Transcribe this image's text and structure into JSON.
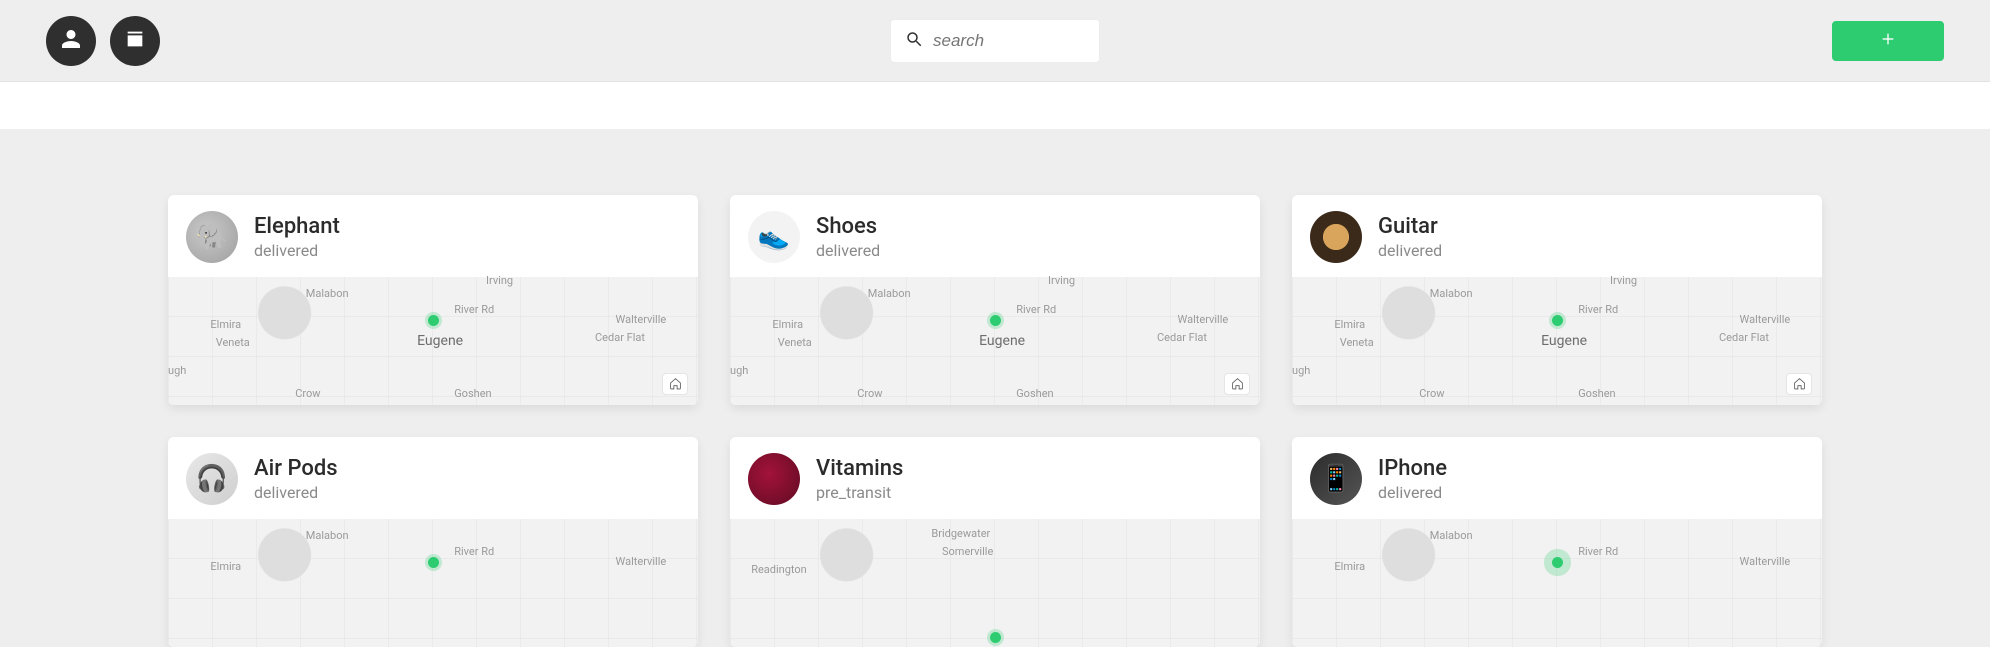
{
  "search": {
    "placeholder": "search"
  },
  "cards": [
    {
      "name": "Elephant",
      "status": "delivered",
      "avatar": "elephant",
      "map": "eugene"
    },
    {
      "name": "Shoes",
      "status": "delivered",
      "avatar": "shoes",
      "map": "eugene"
    },
    {
      "name": "Guitar",
      "status": "delivered",
      "avatar": "guitar",
      "map": "eugene"
    },
    {
      "name": "Air Pods",
      "status": "delivered",
      "avatar": "airpods",
      "map": "eugene"
    },
    {
      "name": "Vitamins",
      "status": "pre_transit",
      "avatar": "vitamins",
      "map": "somerville"
    },
    {
      "name": "IPhone",
      "status": "delivered",
      "avatar": "iphone",
      "map": "eugene"
    }
  ],
  "map_labels": {
    "eugene": {
      "city": "Eugene",
      "malabon": "Malabon",
      "riverrd": "River Rd",
      "elmira": "Elmira",
      "veneta": "Veneta",
      "walterville": "Walterville",
      "cedarflat": "Cedar Flat",
      "goshen": "Goshen",
      "irving": "Irving",
      "ugh": "ugh",
      "crow": "Crow"
    },
    "somerville": {
      "bridgewater": "Bridgewater",
      "somerville": "Somerville",
      "readington": "Readington"
    }
  }
}
